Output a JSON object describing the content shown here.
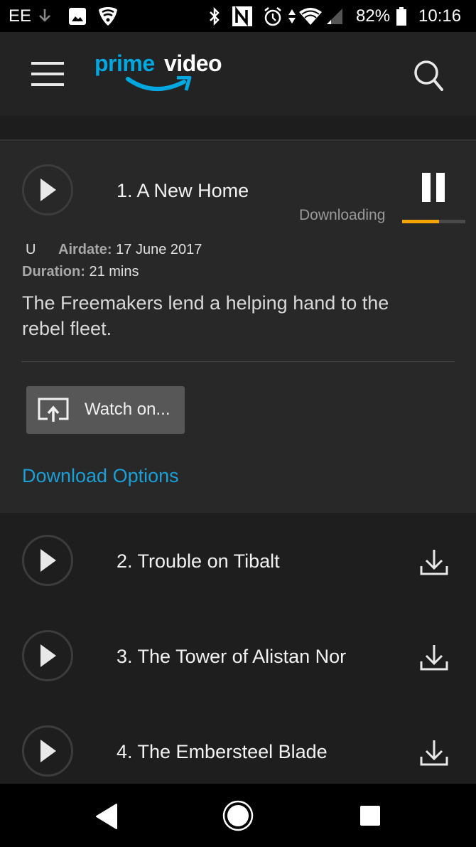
{
  "status_bar": {
    "carrier": "EE",
    "battery": "82%",
    "time": "10:16",
    "icons_left": [
      "download-arrow-icon",
      "image-icon",
      "vpn-shield-icon"
    ],
    "icons_right": [
      "bluetooth-icon",
      "nfc-icon",
      "alarm-icon",
      "data-arrows-icon",
      "wifi-icon",
      "signal-icon",
      "battery-icon"
    ]
  },
  "app_bar": {
    "logo_part1": "prime",
    "logo_part2": "video",
    "brand_color": "#00a8e1",
    "menu_icon": "hamburger-menu-icon",
    "search_icon": "search-icon"
  },
  "episode_expanded": {
    "title": "1. A New Home",
    "status": "Downloading",
    "progress_percent": 58,
    "progress_color": "#f5a500",
    "rating": "U",
    "airdate_label": "Airdate:",
    "airdate_value": "17 June 2017",
    "duration_label": "Duration:",
    "duration_value": "21 mins",
    "synopsis_line1": "The Freemakers lend a helping hand to the",
    "synopsis_line2": "rebel fleet.",
    "watch_on_label": "Watch on...",
    "download_options_label": "Download Options",
    "link_color": "#1a9fd6"
  },
  "episodes": [
    {
      "title": "2. Trouble on Tibalt"
    },
    {
      "title": "3. The Tower of Alistan Nor"
    },
    {
      "title": "4. The Embersteel Blade"
    }
  ],
  "nav_bar": {
    "back": "back-icon",
    "home": "home-icon",
    "recents": "recents-icon"
  }
}
